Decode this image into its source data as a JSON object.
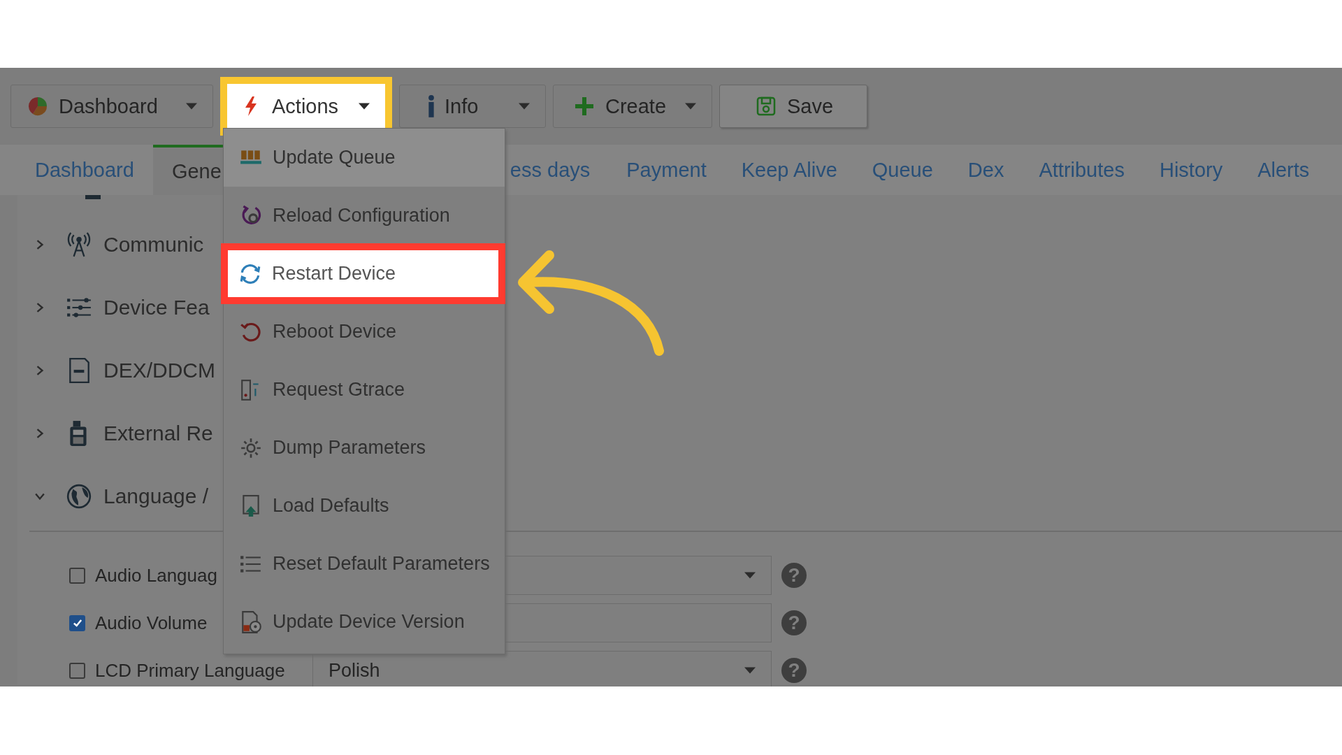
{
  "toolbar": {
    "buttons": [
      {
        "label": "Dashboard",
        "dropdown": true,
        "highlighted": false
      },
      {
        "label": "Actions",
        "dropdown": true,
        "highlighted": true
      },
      {
        "label": "Info",
        "dropdown": true,
        "highlighted": false
      },
      {
        "label": "Create",
        "dropdown": true,
        "highlighted": false
      },
      {
        "label": "Save",
        "dropdown": false,
        "highlighted": false
      }
    ]
  },
  "tabs": [
    {
      "label": "Dashboard",
      "selected": false
    },
    {
      "label": "Gene",
      "selected": true
    },
    {
      "label": "ess days",
      "selected": false
    },
    {
      "label": "Payment",
      "selected": false
    },
    {
      "label": "Keep Alive",
      "selected": false
    },
    {
      "label": "Queue",
      "selected": false
    },
    {
      "label": "Dex",
      "selected": false
    },
    {
      "label": "Attributes",
      "selected": false
    },
    {
      "label": "History",
      "selected": false
    },
    {
      "label": "Alerts",
      "selected": false
    }
  ],
  "sections": [
    {
      "title": "Communic",
      "expanded": false
    },
    {
      "title": "Device Fea",
      "expanded": false
    },
    {
      "title": "DEX/DDCM",
      "expanded": false
    },
    {
      "title": "External Re",
      "expanded": false
    },
    {
      "title": "Language /",
      "expanded": true
    }
  ],
  "fields": [
    {
      "label": "Audio Languag",
      "checked": false,
      "kind": "dropdown",
      "help": "?"
    },
    {
      "label": "Audio Volume",
      "checked": true,
      "kind": "text",
      "help": "?"
    },
    {
      "label": "LCD Primary Language",
      "checked": false,
      "kind": "dropdown",
      "value": "Polish",
      "help": "?"
    }
  ],
  "actions_menu": {
    "items": [
      {
        "label": "Update Queue",
        "hovered": true,
        "highlighted": false
      },
      {
        "label": "Reload Configuration",
        "hovered": false,
        "highlighted": false
      },
      {
        "label": "Restart Device",
        "hovered": false,
        "highlighted": true
      },
      {
        "label": "Reboot Device",
        "hovered": false,
        "highlighted": false
      },
      {
        "label": "Request Gtrace",
        "hovered": false,
        "highlighted": false
      },
      {
        "label": "Dump Parameters",
        "hovered": false,
        "highlighted": false
      },
      {
        "label": "Load Defaults",
        "hovered": false,
        "highlighted": false
      },
      {
        "label": "Reset Default Parameters",
        "hovered": false,
        "highlighted": false
      },
      {
        "label": "Update Device Version",
        "hovered": false,
        "highlighted": false
      }
    ]
  }
}
